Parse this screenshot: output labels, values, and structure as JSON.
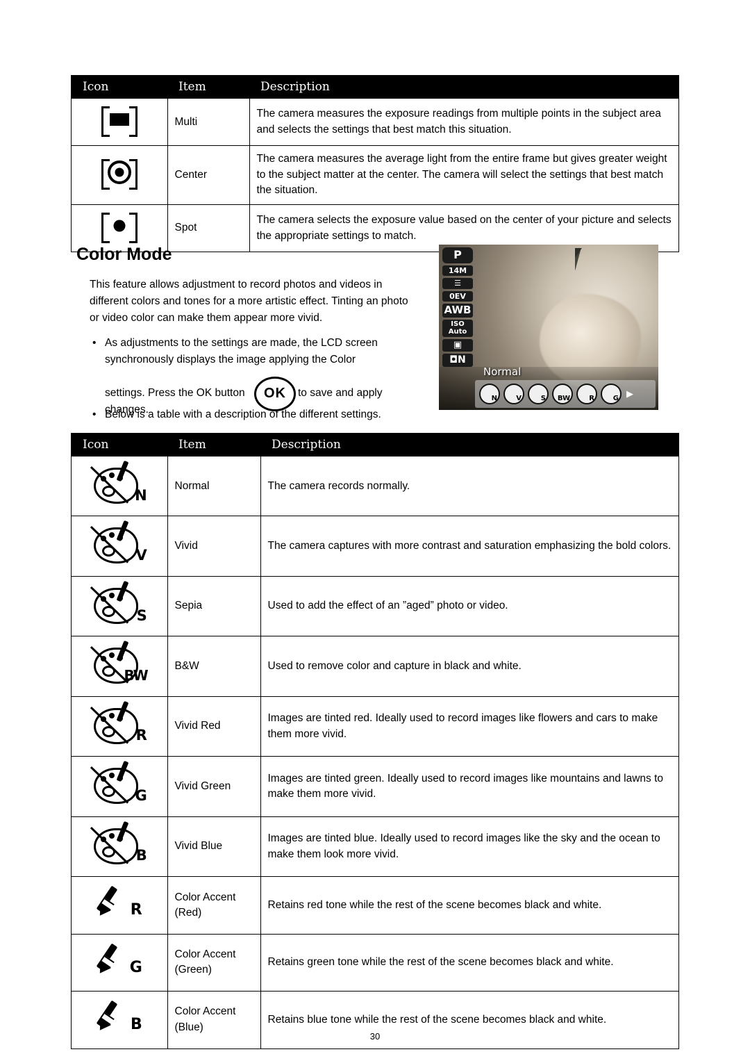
{
  "metering_table": {
    "headers": [
      "Icon",
      "Item",
      "Description"
    ],
    "rows": [
      {
        "icon": "metering-multi-icon",
        "item": "Multi",
        "description": "The camera measures the exposure readings from multiple points in the subject area and selects the settings that best match this situation."
      },
      {
        "icon": "metering-center-icon",
        "item": "Center",
        "description": "The camera measures the average light from the entire frame but gives greater weight to the subject matter at the center. The camera will select the settings that best match the situation."
      },
      {
        "icon": "metering-spot-icon",
        "item": "Spot",
        "description": "The camera selects the exposure value based on the center of your picture and selects the appropriate settings to match."
      }
    ]
  },
  "section": {
    "heading": "Color Mode",
    "paragraph": "This feature allows adjustment to record photos and videos in different colors and tones for a more artistic effect. Tinting an photo or video color can make them appear more vivid.",
    "bullet_symbol": "•",
    "bullet1_line1": "As adjustments to the settings are made, the LCD screen",
    "bullet1_line2": "synchronously displays the image applying the Color",
    "ok_line_before": "settings. Press the OK button",
    "ok_button_label": "OK",
    "ok_line_after": "to save and apply",
    "ok_line_last": "changes.",
    "bullet2": "Below is a table with a description of the different settings."
  },
  "lcd_preview": {
    "icons": [
      "P",
      "14M",
      "≡",
      "0EV",
      "AWB",
      "ISO Auto",
      "▣",
      "palette-N"
    ],
    "mode_label": "P",
    "resolution_label": "14M",
    "quality_label": "☰",
    "ev_label": "0EV",
    "awb_label": "AWB",
    "iso_label": "ISO",
    "iso_value": "Auto",
    "metering_label": "▣",
    "current_label": "Normal",
    "strip": [
      "N",
      "V",
      "S",
      "BW",
      "R",
      "G"
    ],
    "strip_arrow": "▶"
  },
  "color_table": {
    "headers": [
      "Icon",
      "Item",
      "Description"
    ],
    "rows": [
      {
        "icon_type": "palette",
        "icon_letter": "N",
        "item": "Normal",
        "description": "The camera records normally."
      },
      {
        "icon_type": "palette",
        "icon_letter": "V",
        "item": "Vivid",
        "description": "The camera captures with more contrast and saturation emphasizing the bold colors."
      },
      {
        "icon_type": "palette",
        "icon_letter": "S",
        "item": "Sepia",
        "description": "Used to add the effect of an ”aged” photo or video."
      },
      {
        "icon_type": "palette",
        "icon_letter": "BW",
        "item": "B&W",
        "description": "Used to remove color and capture in black and white."
      },
      {
        "icon_type": "palette",
        "icon_letter": "R",
        "item": "Vivid Red",
        "description": "Images are tinted red. Ideally used to record images like flowers and cars to make them more vivid."
      },
      {
        "icon_type": "palette",
        "icon_letter": "G",
        "item": "Vivid Green",
        "description": "Images are tinted green. Ideally used to record images like mountains and lawns to make them more vivid."
      },
      {
        "icon_type": "palette",
        "icon_letter": "B",
        "item": "Vivid Blue",
        "description": "Images are tinted blue. Ideally used to record images like the sky and the ocean to make them look more vivid."
      },
      {
        "icon_type": "brush",
        "icon_letter": "R",
        "item": "Color Accent (Red)",
        "description": "Retains red tone while the rest of the scene becomes black and white."
      },
      {
        "icon_type": "brush",
        "icon_letter": "G",
        "item": "Color Accent (Green)",
        "description": "Retains green tone while the rest of the scene becomes black and white."
      },
      {
        "icon_type": "brush",
        "icon_letter": "B",
        "item": "Color Accent (Blue)",
        "description": "Retains blue tone while the rest of the scene becomes black and white."
      }
    ]
  },
  "footer": {
    "page_number": "30"
  }
}
